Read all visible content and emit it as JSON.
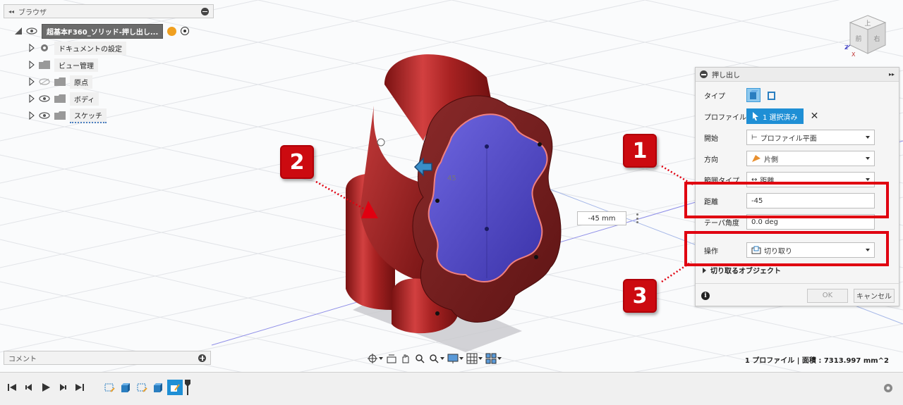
{
  "browser": {
    "title": "ブラウザ",
    "root_label": "超基本F360_ソリッド-押し出し...",
    "items": [
      {
        "label": "ドキュメントの設定",
        "icon": "gear-icon"
      },
      {
        "label": "ビュー管理",
        "icon": "folder-icon"
      },
      {
        "label": "原点",
        "icon": "folder-icon",
        "hidden": true
      },
      {
        "label": "ボディ",
        "icon": "folder-icon"
      },
      {
        "label": "スケッチ",
        "icon": "folder-icon"
      }
    ]
  },
  "comment_bar": {
    "label": "コメント"
  },
  "viewcube": {
    "front": "前",
    "right": "右",
    "top": "上",
    "axis_z": "Z",
    "axis_x": "X"
  },
  "extrude": {
    "title": "押し出し",
    "type_label": "タイプ",
    "profile_label": "プロファイル",
    "profile_value": "1 選択済み",
    "start_label": "開始",
    "start_value": "プロファイル平面",
    "direction_label": "方向",
    "direction_value": "片側",
    "extent_label": "範囲タイプ",
    "extent_value": "距離",
    "distance_label": "距離",
    "distance_value": "-45",
    "taper_label": "テーパ角度",
    "taper_value": "0.0 deg",
    "operation_label": "操作",
    "operation_value": "切り取り",
    "objects_label": "切り取るオブジェクト",
    "ok_label": "OK",
    "cancel_label": "キャンセル"
  },
  "viewport": {
    "distance_box": "-45 mm",
    "arrow_label": "45"
  },
  "callouts": [
    "1",
    "2",
    "3"
  ],
  "status": {
    "text": "1 プロファイル | 面積 : 7313.997 mm^2"
  },
  "colors": {
    "accent": "#1f8fd5",
    "highlight": "#e00010",
    "body_red": "#b82b2b",
    "cut_blue": "#5a52d0"
  }
}
